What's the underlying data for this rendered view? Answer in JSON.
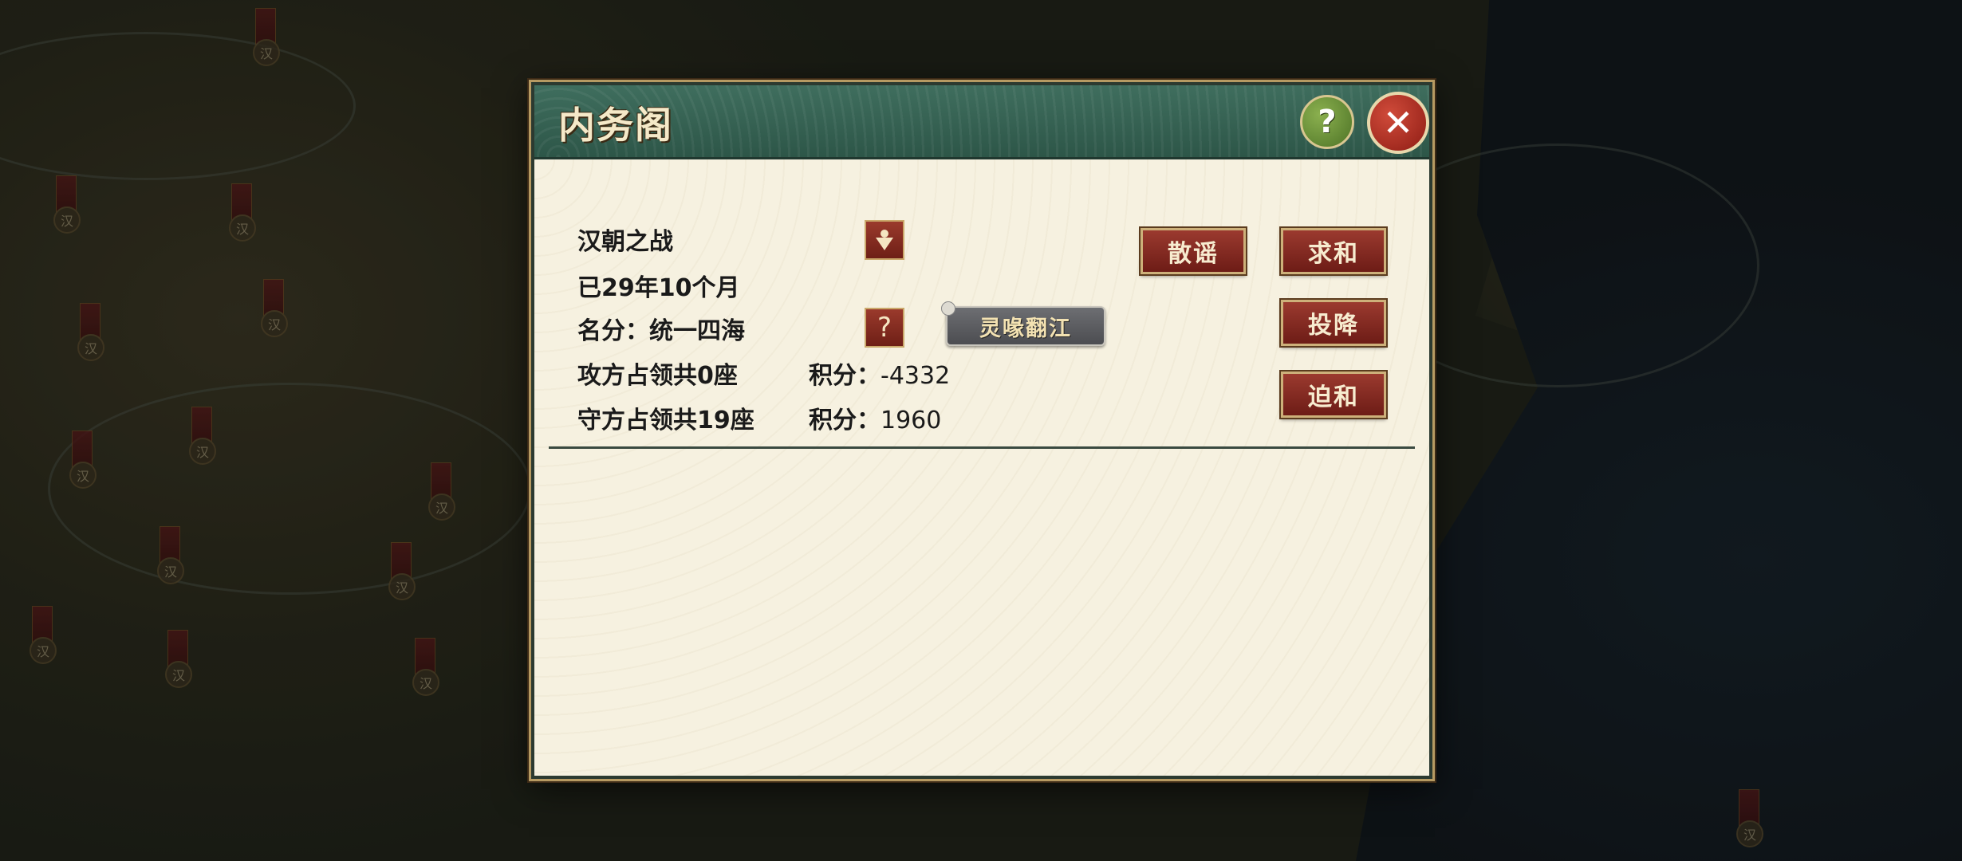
{
  "dialog": {
    "title": "内务阁",
    "help_label": "?",
    "close_label": "✕"
  },
  "war": {
    "name": "汉朝之战",
    "duration": "已29年10个月",
    "title_label": "名分：",
    "title_value": "统一四海",
    "title_info_label": "?",
    "badge": "灵喙翻江",
    "attacker": {
      "label": "攻方占领共0座",
      "score_label": "积分：",
      "score": "-4332"
    },
    "defender": {
      "label": "守方占领共19座",
      "score_label": "积分：",
      "score": "1960"
    }
  },
  "actions": {
    "rumor": "散谣",
    "sue_peace": "求和",
    "surrender": "投降",
    "force_peace": "迫和"
  },
  "map": {
    "city_markers": [
      "汉",
      "汉",
      "汉",
      "汉",
      "汉",
      "汉",
      "汉",
      "汉",
      "汉",
      "汉",
      "汉",
      "汉",
      "汉",
      "汉"
    ]
  }
}
